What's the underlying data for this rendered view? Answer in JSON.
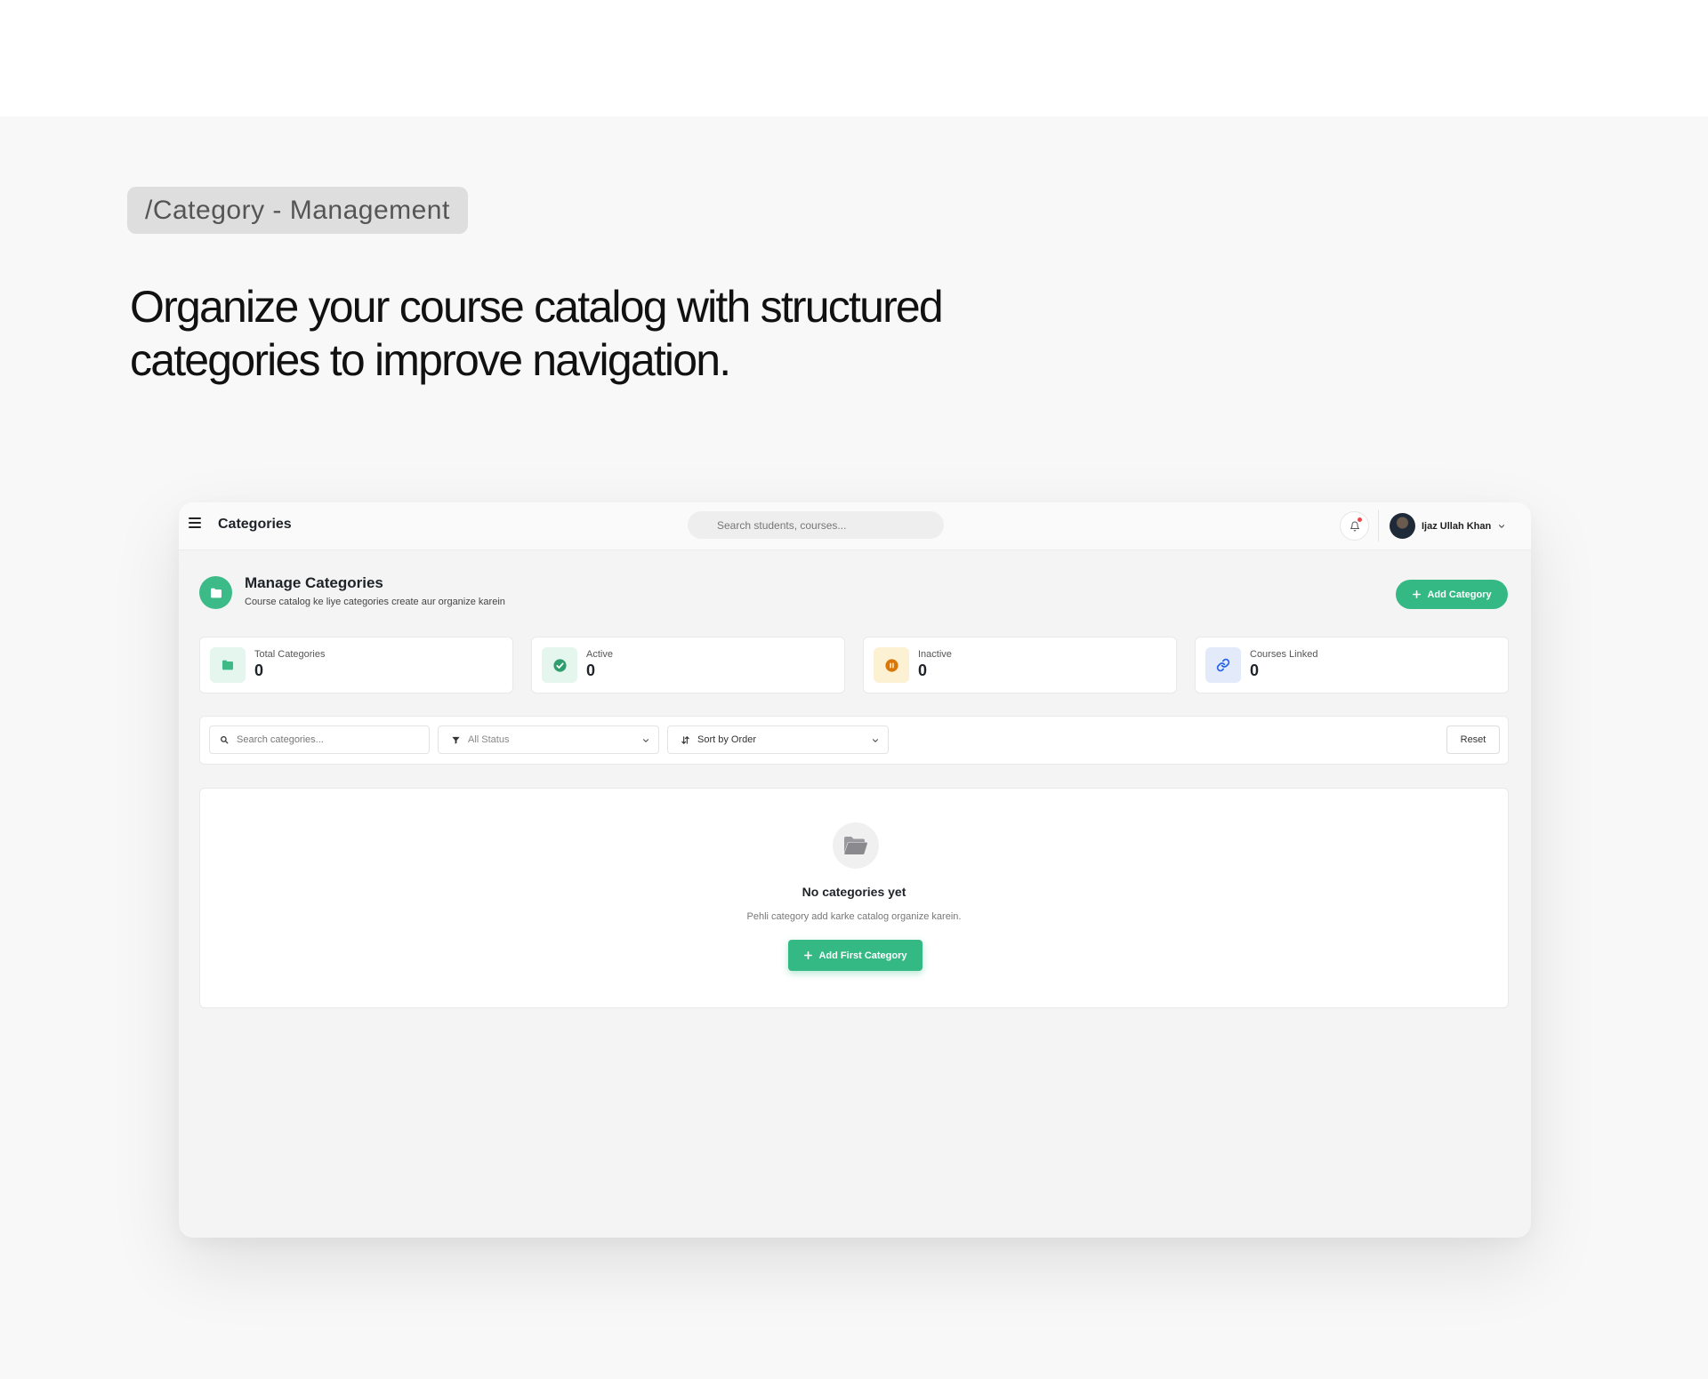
{
  "presentation": {
    "tag": "/Category - Management",
    "headline": "Organize your course catalog with structured categories to improve navigation."
  },
  "appbar": {
    "title": "Categories",
    "search_placeholder": "Search students, courses...",
    "user_name": "Ijaz Ullah Khan",
    "notification_indicator": true
  },
  "page": {
    "title": "Manage Categories",
    "subtitle": "Course catalog ke liye categories create aur organize karein",
    "add_button": "Add Category"
  },
  "stats": [
    {
      "label": "Total Categories",
      "value": "0",
      "icon": "folder-icon",
      "bg": "#e4f6ee",
      "color": "#3cba87"
    },
    {
      "label": "Active",
      "value": "0",
      "icon": "check-circle-icon",
      "bg": "#e4f6ee",
      "color": "#2f9e6e"
    },
    {
      "label": "Inactive",
      "value": "0",
      "icon": "pause-circle-icon",
      "bg": "#fdf1d3",
      "color": "#d97706"
    },
    {
      "label": "Courses Linked",
      "value": "0",
      "icon": "link-icon",
      "bg": "#e3ebfb",
      "color": "#2563eb"
    }
  ],
  "filters": {
    "search_placeholder": "Search categories...",
    "status_selected": "All Status",
    "sort_selected": "Sort by Order",
    "reset_label": "Reset"
  },
  "empty_state": {
    "title": "No categories yet",
    "text": "Pehli category add karke catalog organize karein.",
    "button": "Add First Category",
    "icon": "open-folder-icon"
  },
  "colors": {
    "accent": "#34b984",
    "background": "#f4f4f5"
  }
}
